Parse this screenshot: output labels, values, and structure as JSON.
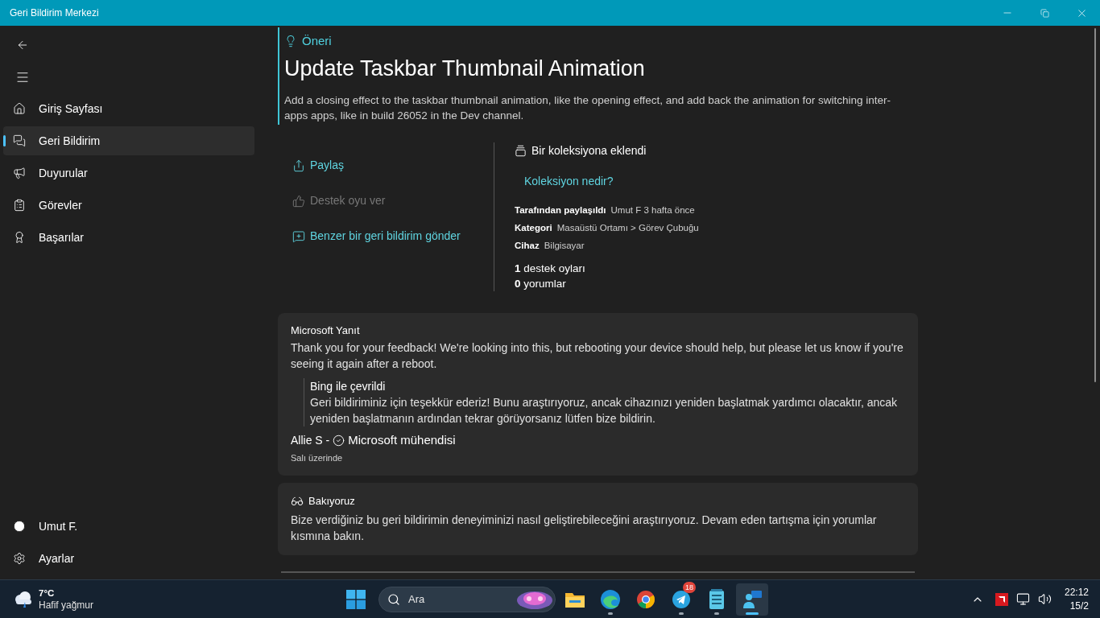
{
  "window": {
    "title": "Geri Bildirim Merkezi"
  },
  "sidebar": {
    "items": [
      {
        "kind": "home",
        "label": "Giriş Sayfası",
        "selected": false
      },
      {
        "kind": "feedback",
        "label": "Geri Bildirim",
        "selected": true
      },
      {
        "kind": "announce",
        "label": "Duyurular",
        "selected": false
      },
      {
        "kind": "quests",
        "label": "Görevler",
        "selected": false
      },
      {
        "kind": "achievements",
        "label": "Başarılar",
        "selected": false
      }
    ],
    "footer": [
      {
        "kind": "user",
        "label": "Umut F."
      },
      {
        "kind": "settings",
        "label": "Ayarlar"
      }
    ]
  },
  "post": {
    "type_label": "Öneri",
    "title": "Update Taskbar Thumbnail Animation",
    "description": "Add a closing effect to the taskbar thumbnail animation, like the opening effect, and add back the animation for switching inter-apps apps, like in build 26052 in the Dev channel."
  },
  "actions": [
    {
      "kind": "share",
      "label": "Paylaş",
      "disabled": false
    },
    {
      "kind": "upvote",
      "label": "Destek oyu ver",
      "disabled": true
    },
    {
      "kind": "similar",
      "label": "Benzer bir geri bildirim gönder",
      "disabled": false
    }
  ],
  "details": {
    "collection_status": "Bir koleksiyona eklendi",
    "collection_link": "Koleksiyon nedir?",
    "fields": [
      {
        "label": "Tarafından paylaşıldı",
        "value": "Umut F 3 hafta önce"
      },
      {
        "label": "Kategori",
        "value": "Masaüstü Ortamı > Görev Çubuğu"
      },
      {
        "label": "Cihaz",
        "value": "Bilgisayar"
      }
    ],
    "stats": [
      "**1** destek oyları",
      "**0** yorumlar"
    ]
  },
  "response": {
    "heading": "Microsoft Yanıt",
    "body": "Thank you for your feedback! We're looking into this, but rebooting your device should help, but please let us know if you're seeing it again after a reboot.",
    "translation": {
      "heading": "Bing ile çevrildi",
      "body": "Geri bildiriminiz için teşekkür ederiz! Bunu araştırıyoruz, ancak cihazınızı yeniden başlatmak yardımcı olacaktır, ancak yeniden başlatmanın ardından tekrar görüyorsanız lütfen bize bildirin."
    },
    "author": "Allie S -",
    "role": "Microsoft mühendisi",
    "time": "Salı üzerinde"
  },
  "status_card": {
    "heading": "Bakıyoruz",
    "body": "Bize verdiğiniz bu geri bildirimin deneyiminizi nasıl geliştirebileceğini araştırıyoruz. Devam eden tartışma için yorumlar kısmına bakın."
  },
  "taskbar": {
    "weather": {
      "temperature": "7°C",
      "condition": "Hafif yağmur"
    },
    "search": {
      "placeholder": "Ara"
    },
    "apps": [
      {
        "kind": "explorer",
        "running": false,
        "selected": false
      },
      {
        "kind": "edge",
        "running": true,
        "selected": false
      },
      {
        "kind": "chrome",
        "running": false,
        "selected": false
      },
      {
        "kind": "telegram",
        "running": true,
        "selected": false,
        "badge": "18"
      },
      {
        "kind": "notepad",
        "running": true,
        "selected": false
      },
      {
        "kind": "feedback",
        "running": true,
        "selected": true
      }
    ],
    "clock": {
      "time": "22:12",
      "date": "15/2"
    }
  }
}
